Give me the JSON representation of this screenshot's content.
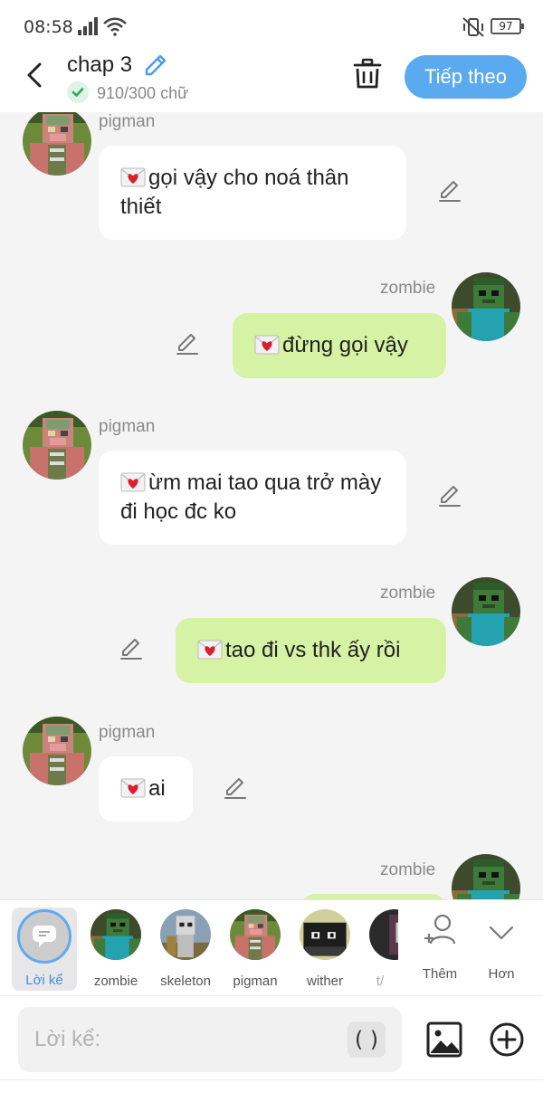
{
  "status": {
    "time": "08:58",
    "battery": "97"
  },
  "header": {
    "title": "chap 3",
    "word_count": "910/300 chữ",
    "next_label": "Tiếp theo"
  },
  "messages": [
    {
      "side": "left",
      "sender": "pigman",
      "text": "gọi vậy cho noá thân thiết"
    },
    {
      "side": "right",
      "sender": "zombie",
      "text": "đừng gọi vậy"
    },
    {
      "side": "left",
      "sender": "pigman",
      "text": "ừm mai tao qua trở mày đi học đc ko"
    },
    {
      "side": "right",
      "sender": "zombie",
      "text": "tao đi vs thk ấy rồi"
    },
    {
      "side": "left",
      "sender": "pigman",
      "text": "ai"
    },
    {
      "side": "right",
      "sender": "zombie",
      "text": ""
    }
  ],
  "characters": [
    {
      "label": "Lời kể",
      "selected": true
    },
    {
      "label": "zombie"
    },
    {
      "label": "skeleton"
    },
    {
      "label": "pigman"
    },
    {
      "label": "wither"
    },
    {
      "label": "t/"
    }
  ],
  "actions": {
    "more_chars": "Thêm",
    "expand": "Hơn"
  },
  "input": {
    "placeholder": "Lời kể:",
    "paren": "( )"
  },
  "colors": {
    "accent": "#5aaaf0",
    "right_bubble": "#d6f2a5",
    "left_bubble": "#ffffff"
  }
}
